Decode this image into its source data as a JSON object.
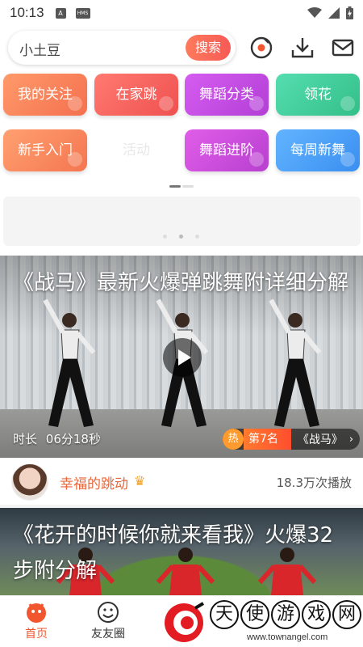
{
  "status_bar": {
    "time": "10:13",
    "icons": [
      "notification-a-icon",
      "hms-icon",
      "wifi-icon",
      "signal-icon",
      "battery-icon"
    ],
    "icon_a_label": "A",
    "icon_hms_label": "HMS"
  },
  "search": {
    "value": "小土豆",
    "button_label": "搜索",
    "right_icons": [
      "music-disc-icon",
      "download-icon",
      "mail-icon"
    ]
  },
  "categories": [
    {
      "label": "我的关注",
      "color": "#f77f58"
    },
    {
      "label": "在家跳",
      "color": "#f2605d"
    },
    {
      "label": "舞蹈分类",
      "color": "#c44be0"
    },
    {
      "label": "领花",
      "color": "#3fcb98"
    },
    {
      "label": "新手入门",
      "color": "#f78a5c"
    },
    {
      "label": "活动",
      "color": "#ffffff"
    },
    {
      "label": "舞蹈进阶",
      "color": "#c94bd9"
    },
    {
      "label": "每周新舞",
      "color": "#4a9ef2"
    }
  ],
  "videos": [
    {
      "title": "《战马》最新火爆弹跳舞附详细分解",
      "duration_label": "时长",
      "duration": "06分18秒",
      "rank_hot": "热",
      "rank": "第7名",
      "rank_song": "《战马》",
      "author": "幸福的跳动",
      "plays": "18.3万次播放"
    },
    {
      "title": "《花开的时候你就来看我》火爆32步附分解"
    }
  ],
  "bottom_nav": [
    {
      "label": "首页",
      "active": true
    },
    {
      "label": "友友圈",
      "active": false
    }
  ],
  "watermark": {
    "chars": [
      "天",
      "使",
      "游",
      "戏",
      "网"
    ],
    "url": "www.townangel.com"
  },
  "colors": {
    "accent": "#f2562e",
    "search_button": "#f65a56"
  }
}
